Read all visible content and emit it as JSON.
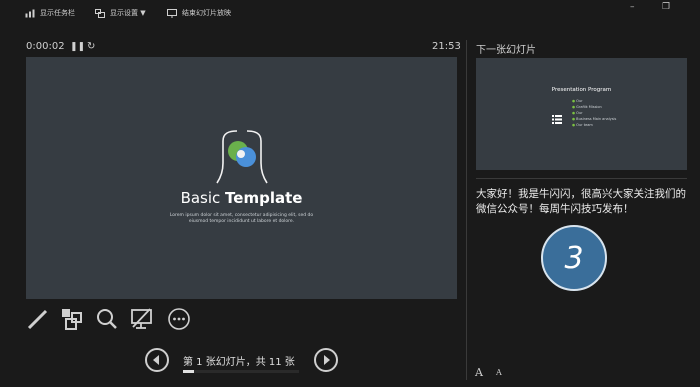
{
  "toolbar": {
    "show_taskbar": "显示任务栏",
    "display_settings": "显示设置 ▼",
    "end_show": "结束幻灯片放映",
    "minimize": "–",
    "restore": "❐"
  },
  "presenter": {
    "elapsed": "0:00:02",
    "pause_symbol": "❚❚",
    "reset_symbol": "↻",
    "clock": "21:53"
  },
  "current_slide": {
    "title_regular": "Basic ",
    "title_bold": "Template",
    "subtitle_line1": "Lorem ipsum dolor sit amet, consectetur adipisicing elit, sed do",
    "subtitle_line2": "eiusmod tempor incididunt ut labore et dolore."
  },
  "next_slide": {
    "label": "下一张幻灯片",
    "title": "Presentation Program",
    "items": [
      "Our",
      "Grafiik Mission",
      "Our",
      "Business Main analysis",
      "Our team"
    ]
  },
  "notes": {
    "text": "大家好！我是牛闪闪，很高兴大家关注我们的微信公众号！每周牛闪技巧发布！",
    "badge": "3"
  },
  "navigation": {
    "slide_counter": "第 1 张幻灯片，共 11 张",
    "progress_fraction": 0.0909,
    "font_larger": "A",
    "font_smaller": "A"
  },
  "tools": [
    "pen-icon",
    "all-slides-icon",
    "zoom-icon",
    "black-screen-icon",
    "more-options-icon"
  ]
}
